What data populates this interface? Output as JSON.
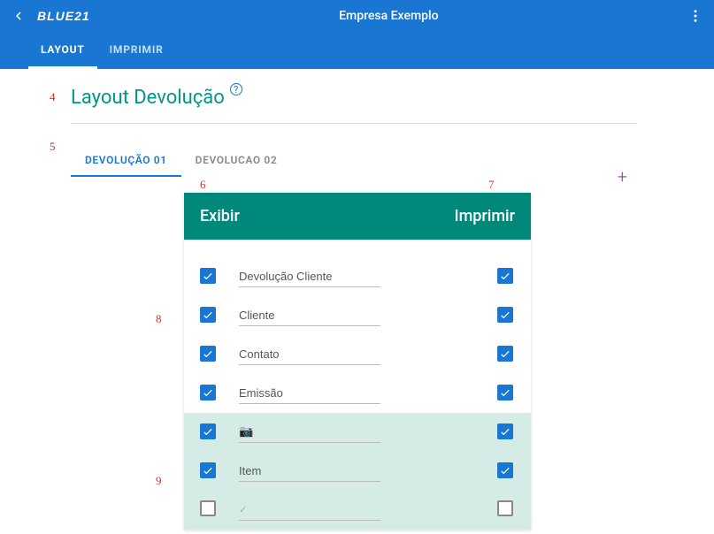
{
  "header": {
    "logo": "BLUE21",
    "company": "Empresa Exemplo"
  },
  "topTabs": {
    "layout": "LAYOUT",
    "imprimir": "IMPRIMIR"
  },
  "page": {
    "title": "Layout Devolução"
  },
  "subTabs": {
    "tab1": "DEVOLUÇÃO 01",
    "tab2": "DEVOLUCAO 02"
  },
  "tableHeader": {
    "exibir": "Exibir",
    "imprimir": "Imprimir"
  },
  "markers": {
    "m4": "4",
    "m5": "5",
    "m6": "6",
    "m7": "7",
    "m8": "8",
    "m9": "9"
  },
  "rows": [
    {
      "label": "Devolução Cliente",
      "exibir": true,
      "imprimir": true,
      "shaded": false,
      "glyph": null
    },
    {
      "label": "Cliente",
      "exibir": true,
      "imprimir": true,
      "shaded": false,
      "glyph": null
    },
    {
      "label": "Contato",
      "exibir": true,
      "imprimir": true,
      "shaded": false,
      "glyph": null
    },
    {
      "label": "Emissão",
      "exibir": true,
      "imprimir": true,
      "shaded": false,
      "glyph": null
    },
    {
      "label": "",
      "exibir": true,
      "imprimir": true,
      "shaded": true,
      "glyph": "camera"
    },
    {
      "label": "Item",
      "exibir": true,
      "imprimir": true,
      "shaded": true,
      "glyph": null
    },
    {
      "label": "",
      "exibir": false,
      "imprimir": false,
      "shaded": true,
      "glyph": "check"
    }
  ]
}
